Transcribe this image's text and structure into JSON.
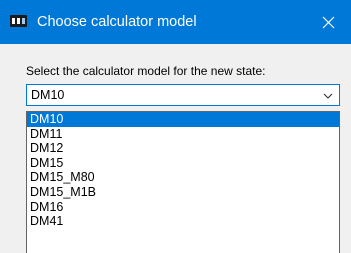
{
  "window": {
    "title": "Choose calculator model",
    "icon": "app-icon",
    "close_symbol": "close-icon"
  },
  "prompt": "Select the calculator model for the new state:",
  "select": {
    "value": "DM10",
    "arrow_icon": "chevron-down-icon"
  },
  "options": [
    {
      "label": "DM10",
      "selected": true
    },
    {
      "label": "DM11",
      "selected": false
    },
    {
      "label": "DM12",
      "selected": false
    },
    {
      "label": "DM15",
      "selected": false
    },
    {
      "label": "DM15_M80",
      "selected": false
    },
    {
      "label": "DM15_M1B",
      "selected": false
    },
    {
      "label": "DM16",
      "selected": false
    },
    {
      "label": "DM41",
      "selected": false
    }
  ],
  "colors": {
    "titlebar": "#0078d7",
    "highlight": "#0078d7",
    "background": "#f0f0f0"
  }
}
